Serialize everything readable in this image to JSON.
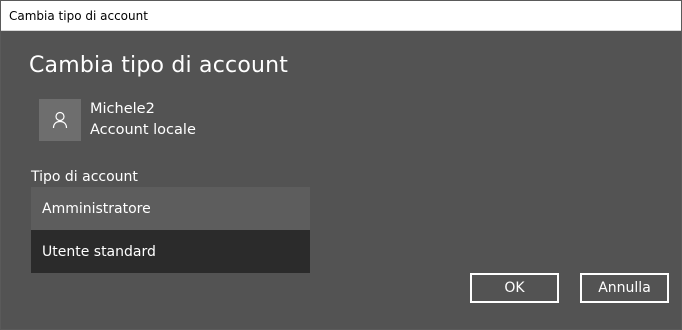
{
  "window": {
    "title": "Cambia tipo di account"
  },
  "dialog": {
    "heading": "Cambia tipo di account",
    "user": {
      "name": "Michele2",
      "account_kind": "Account locale",
      "icon": "person-icon"
    },
    "account_type_label": "Tipo di account",
    "options": [
      {
        "label": "Amministratore",
        "state": "hovered"
      },
      {
        "label": "Utente standard",
        "state": "selected"
      }
    ],
    "buttons": {
      "ok": "OK",
      "cancel": "Annulla"
    }
  },
  "colors": {
    "background": "#535353",
    "hover_option": "#5d5d5d",
    "selected_option": "#2b2b2b",
    "avatar_bg": "#6e6e6e",
    "text": "#ffffff"
  }
}
